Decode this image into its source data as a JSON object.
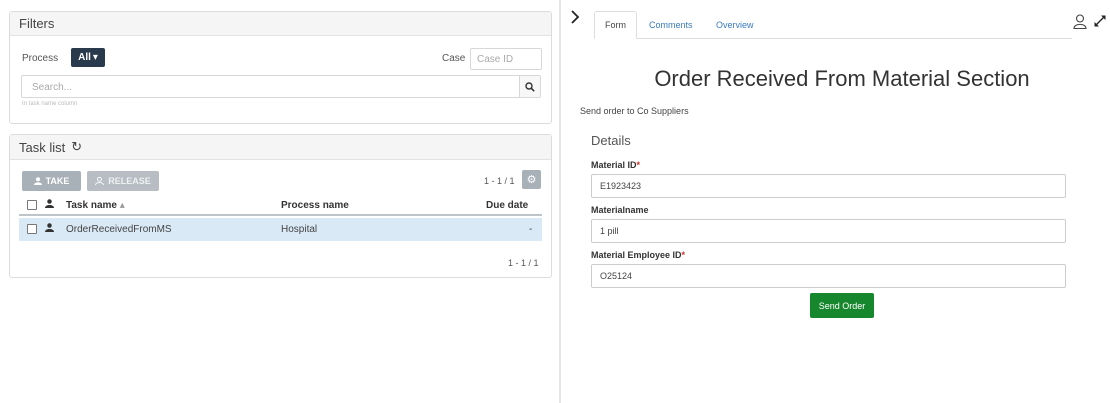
{
  "filters": {
    "title": "Filters",
    "process_label": "Process",
    "process_value": "All",
    "case_label": "Case",
    "case_placeholder": "Case ID",
    "search_placeholder": "Search...",
    "search_hint": "In task name column"
  },
  "tasklist": {
    "title": "Task list",
    "take_label": "TAKE",
    "release_label": "RELEASE",
    "pagination_top": "1 - 1 / 1",
    "pagination_bottom": "1 - 1 / 1",
    "columns": {
      "task_name": "Task name",
      "sort_indicator": "▴",
      "process_name": "Process name",
      "due_date": "Due date"
    },
    "rows": [
      {
        "task_name": "OrderReceivedFromMS",
        "process_name": "Hospital",
        "due_date": "-"
      }
    ]
  },
  "form_panel": {
    "tabs": [
      {
        "label": "Form"
      },
      {
        "label": "Comments"
      },
      {
        "label": "Overview"
      }
    ],
    "title": "Order Received From Material Section",
    "subtitle": "Send order to Co Suppliers",
    "section": "Details",
    "fields": [
      {
        "label": "Material ID",
        "required_mark": "*",
        "value": "E1923423"
      },
      {
        "label": "Materialname",
        "value": "1 pill"
      },
      {
        "label": "Material Employee ID",
        "required_mark": "*",
        "value": "O25124"
      }
    ],
    "submit_label": "Send Order"
  },
  "colors": {
    "accent_dark": "#283a4c",
    "selected_row": "#d9e9f5",
    "submit_green": "#17872d",
    "link_blue": "#3a7bbf"
  },
  "icons": [
    "search-icon",
    "refresh-icon",
    "user-icon",
    "users-icon",
    "gear-icon",
    "chevron-right-icon",
    "expand-icon",
    "caret-down-icon"
  ]
}
